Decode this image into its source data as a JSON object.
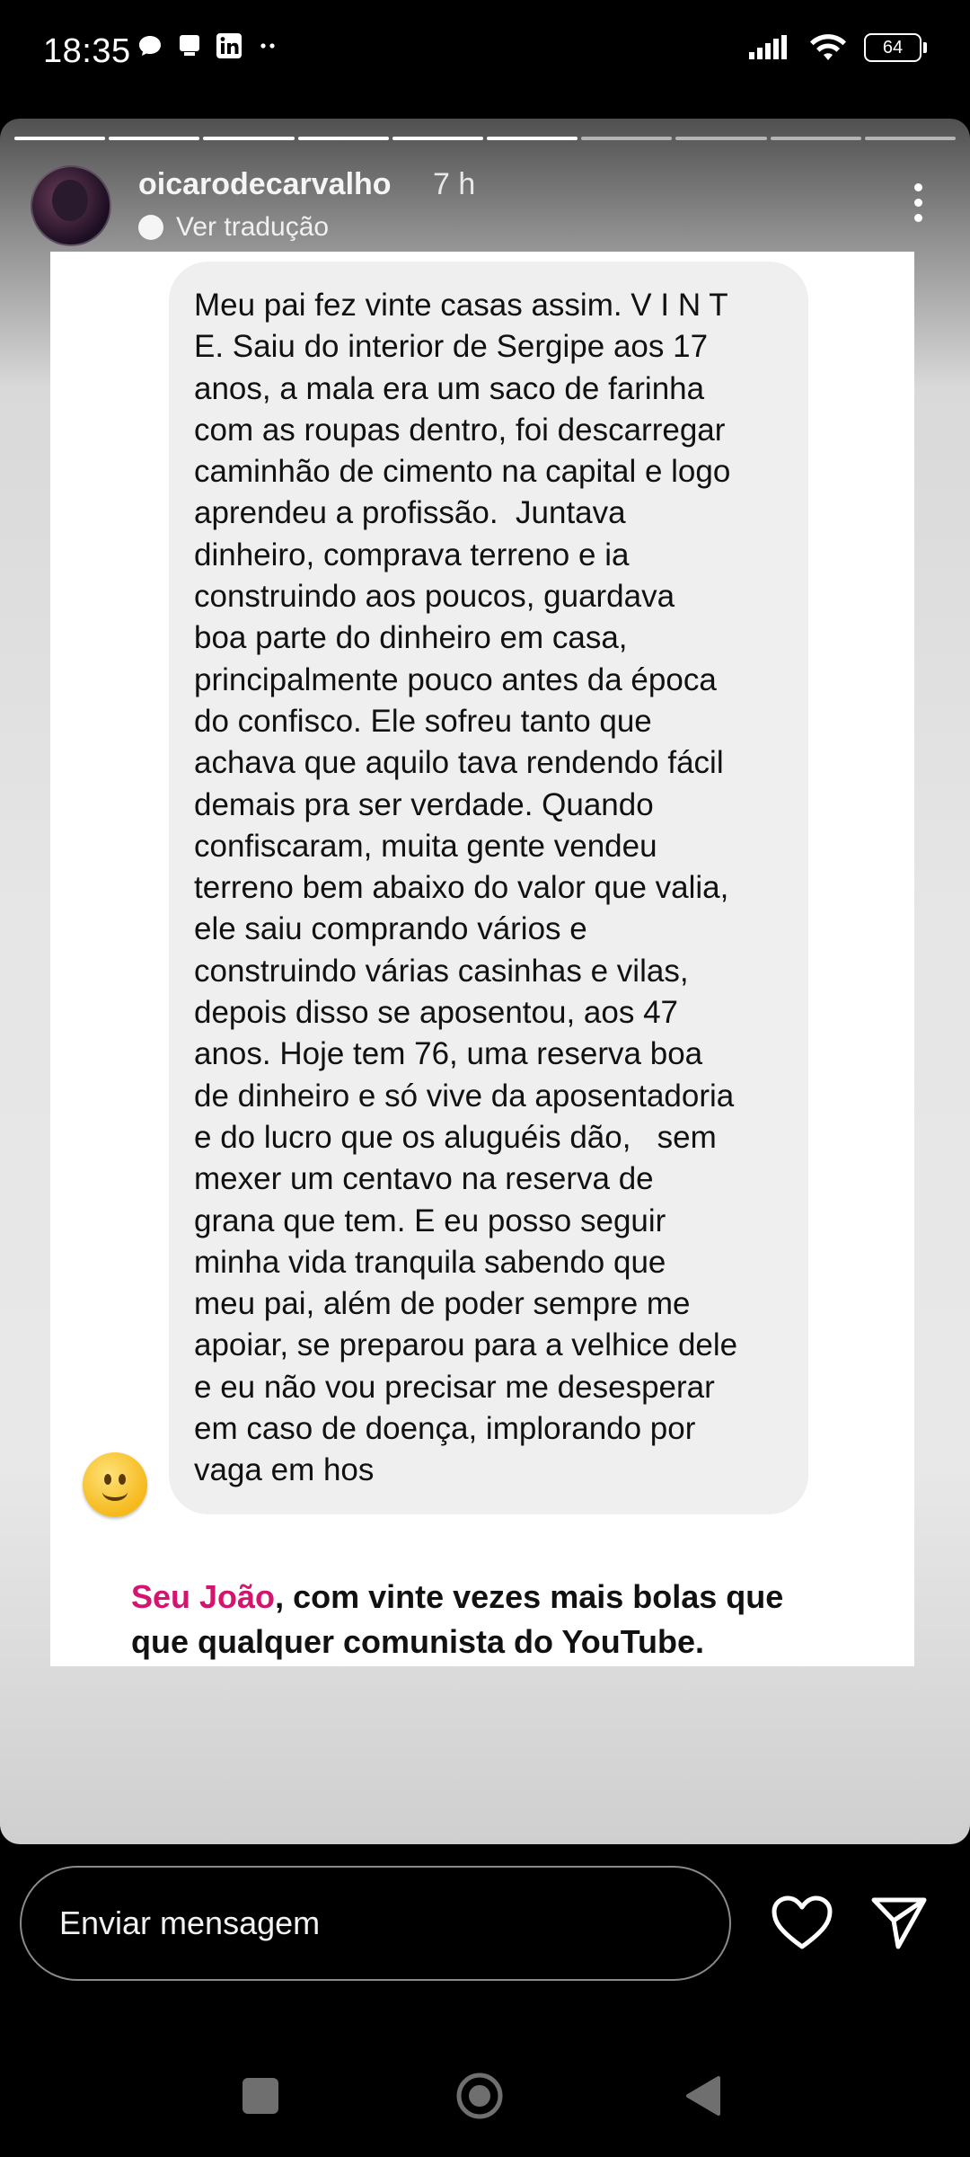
{
  "status_bar": {
    "time": "18:35",
    "left_icons": [
      "chat-bubble-icon",
      "notification-icon",
      "linkedin-icon",
      "more-dots-icon"
    ],
    "battery": "64",
    "right_icons": [
      "signal-icon",
      "wifi-icon",
      "battery-icon"
    ]
  },
  "story": {
    "progress_segments_total": 10,
    "progress_segments_done": 6,
    "username": "oicarodecarvalho",
    "time_ago": "7 h",
    "translate_label": "Ver tradução",
    "comment_lines": [
      "Meu pai fez vinte casas assim. V I N T",
      "E. Saiu do interior de Sergipe aos 17",
      "anos, a mala era um saco de farinha",
      "com as roupas dentro, foi descarregar",
      "caminhão de cimento na capital e logo",
      "aprendeu a profissão.  Juntava",
      "dinheiro, comprava terreno e ia",
      "construindo aos poucos, guardava",
      "boa parte do dinheiro em casa,",
      "principalmente pouco antes da época",
      "do confisco. Ele sofreu tanto que",
      "achava que aquilo tava rendendo fácil",
      "demais pra ser verdade. Quando",
      "confiscaram, muita gente vendeu",
      "terreno bem abaixo do valor que valia,",
      "ele saiu comprando vários e",
      "construindo várias casinhas e vilas,",
      "depois disso se aposentou, aos 47",
      "anos. Hoje tem 76, uma reserva boa",
      "de dinheiro e só vive da aposentadoria",
      "e do lucro que os aluguéis dão,   sem",
      "mexer um centavo na reserva de",
      "grana que tem. E eu posso seguir",
      "minha vida tranquila sabendo que",
      "meu pai, além de poder sempre me",
      "apoiar, se preparou para a velhice dele",
      "e eu não vou precisar me desesperar",
      "em caso de doença, implorando por",
      "vaga em hos"
    ],
    "caption_highlight": "Seu João",
    "caption_line1_rest": ", com vinte vezes mais bolas que",
    "caption_line2": "que qualquer comunista do YouTube."
  },
  "bottom": {
    "message_placeholder": "Enviar mensagem"
  },
  "colors": {
    "highlight": "#d4146e",
    "bubble": "#efefef"
  }
}
